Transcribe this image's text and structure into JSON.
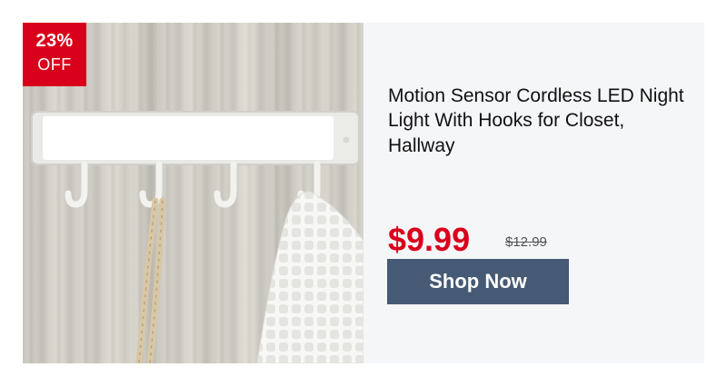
{
  "badge": {
    "percent": "23%",
    "label": "OFF"
  },
  "product": {
    "title": "Motion Sensor Cordless LED Night Light With Hooks for Closet, Hallway",
    "price": "$9.99",
    "original_price": "$12.99",
    "image_subject": "led-light-bar-with-hooks"
  },
  "cta": {
    "label": "Shop Now"
  },
  "colors": {
    "accent_red": "#d9001b",
    "button": "#465a75",
    "panel": "#f5f6f8"
  }
}
